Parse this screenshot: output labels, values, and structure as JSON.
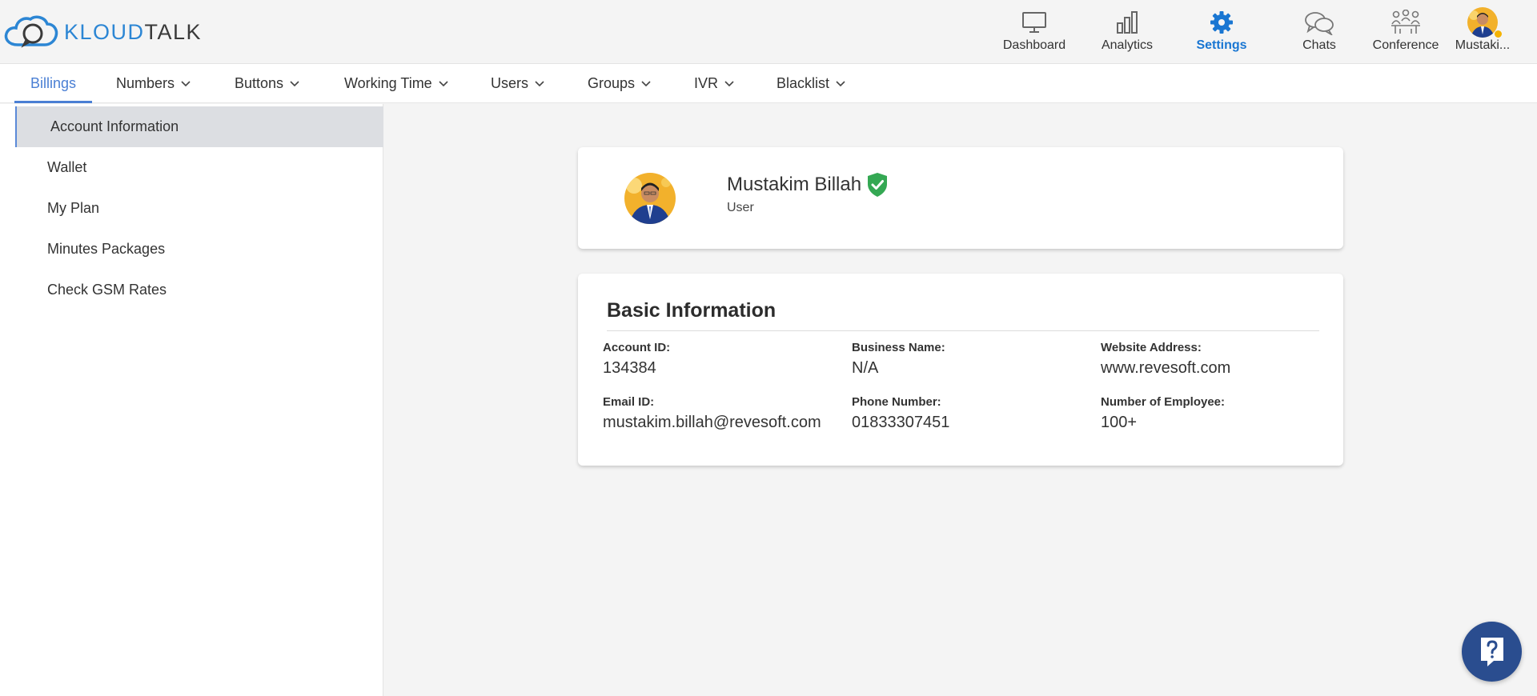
{
  "brand": {
    "part1": "KLOUD",
    "part2": "TALK"
  },
  "top_nav": {
    "dashboard": "Dashboard",
    "analytics": "Analytics",
    "settings": "Settings",
    "chats": "Chats",
    "conference": "Conference",
    "profile": "Mustaki..."
  },
  "tabs": {
    "billings": "Billings",
    "numbers": "Numbers",
    "buttons": "Buttons",
    "working_time": "Working Time",
    "users": "Users",
    "groups": "Groups",
    "ivr": "IVR",
    "blacklist": "Blacklist"
  },
  "sidebar": {
    "items": [
      "Account Information",
      "Wallet",
      "My Plan",
      "Minutes Packages",
      "Check GSM Rates"
    ]
  },
  "profile": {
    "name": "Mustakim Billah",
    "role": "User"
  },
  "basic_info": {
    "title": "Basic Information",
    "account_id_label": "Account ID:",
    "account_id": "134384",
    "business_name_label": "Business Name:",
    "business_name": "N/A",
    "website_label": "Website Address:",
    "website": "www.revesoft.com",
    "email_label": "Email ID:",
    "email": "mustakim.billah@revesoft.com",
    "phone_label": "Phone Number:",
    "phone": "01833307451",
    "employees_label": "Number of Employee:",
    "employees": "100+"
  },
  "colors": {
    "accent": "#1976d2",
    "tab_active": "#4a7fd4",
    "verified": "#34a853",
    "help_button": "#2a4d8f",
    "status_dot": "#f5b301"
  },
  "icons": {
    "help": "question-mark-icon",
    "verified": "verified-shield-icon"
  }
}
